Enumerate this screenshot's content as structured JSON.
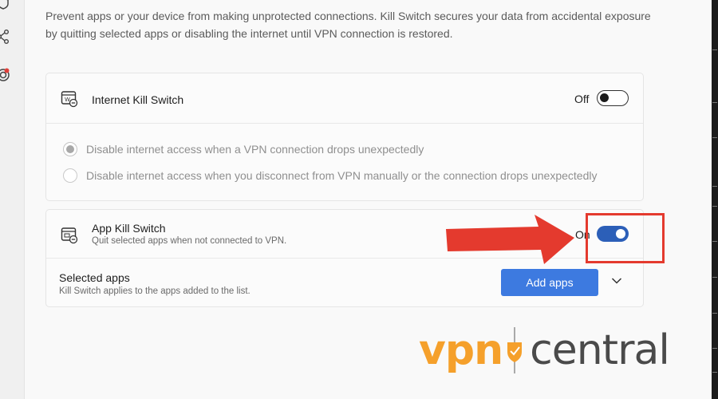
{
  "description": "Prevent apps or your device from making unprotected connections. Kill Switch secures your data from accidental exposure by quitting selected apps or disabling the internet until VPN connection is restored.",
  "rail": {
    "icons": [
      "shield-icon",
      "share-icon",
      "target-icon"
    ]
  },
  "internet_kill_switch": {
    "title": "Internet Kill Switch",
    "state_label": "Off",
    "options": [
      "Disable internet access when a VPN connection drops unexpectedly",
      "Disable internet access when you disconnect from VPN manually or the connection drops unexpectedly"
    ],
    "selected_option": 0
  },
  "app_kill_switch": {
    "title": "App Kill Switch",
    "subtitle": "Quit selected apps when not connected to VPN.",
    "state_label": "On"
  },
  "selected_apps": {
    "title": "Selected apps",
    "subtitle": "Kill Switch applies to the apps added to the list.",
    "add_button": "Add apps"
  },
  "watermark": {
    "left": "vpn",
    "right": "central"
  },
  "colors": {
    "accent": "#3d7ae0",
    "toggle_on": "#2c5fb8",
    "annotation_red": "#e43a2e",
    "watermark_orange": "#f5a02b"
  }
}
